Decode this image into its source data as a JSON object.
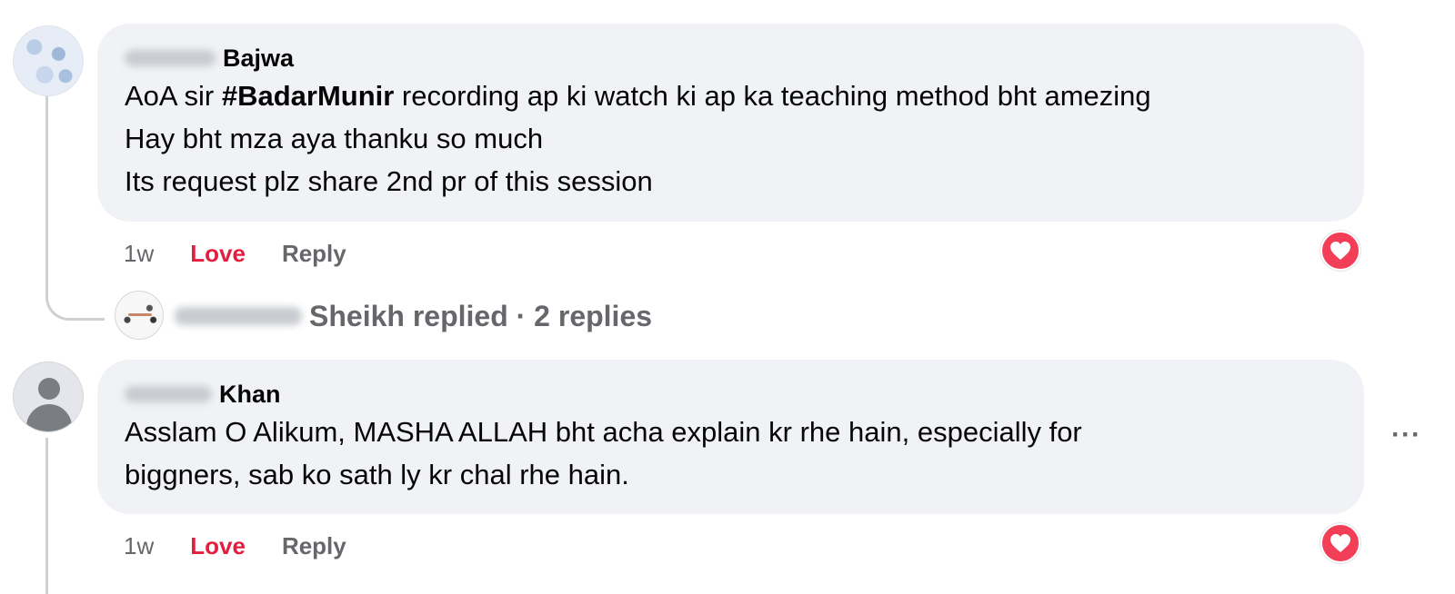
{
  "comments": [
    {
      "author_last": "Bajwa",
      "text_prefix": "AoA sir ",
      "hashtag": "#BadarMunir",
      "text_line1_rest": " recording ap ki watch ki ap ka teaching method bht amezing",
      "text_line2": "Hay bht mza aya thanku so much",
      "text_line3": "Its request plz share 2nd pr of this session",
      "time": "1w",
      "reaction_label": "Love",
      "reply_label": "Reply",
      "reaction_icon": "heart-icon",
      "replies_summary": {
        "replier_last": "Sheikh",
        "text": "replied · 2 replies"
      }
    },
    {
      "author_last": "Khan",
      "text_line1": "Asslam O Alikum, MASHA ALLAH bht acha explain kr rhe hain, especially for",
      "text_line2": "biggners, sab ko sath ly kr chal rhe hain.",
      "time": "1w",
      "reaction_label": "Love",
      "reply_label": "Reply",
      "reaction_icon": "heart-icon",
      "more_label": "···"
    }
  ],
  "colors": {
    "bubble": "#f0f2f5",
    "love": "#e41e3f",
    "muted": "#65676b",
    "reaction": "#f33e58"
  }
}
